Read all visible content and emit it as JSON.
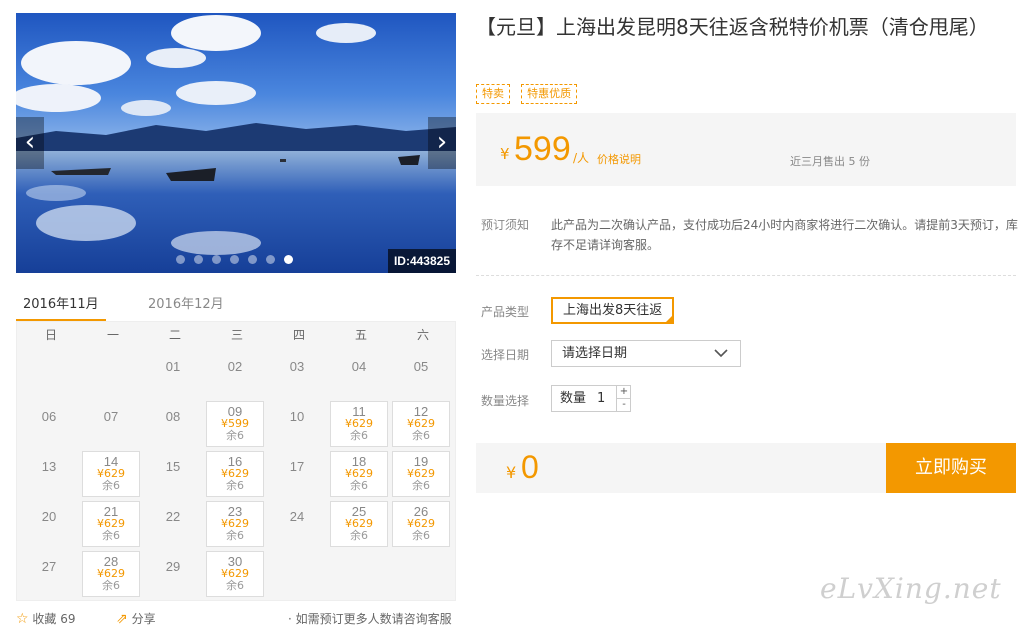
{
  "gallery": {
    "id_label": "ID:443825",
    "prev_glyph": "‹",
    "next_glyph": "›",
    "dot_count": 7,
    "active_dot": 6
  },
  "calendar": {
    "month_tabs": [
      {
        "label": "2016年11月",
        "active": true
      },
      {
        "label": "2016年12月",
        "active": false
      }
    ],
    "weekdays": [
      "日",
      "一",
      "二",
      "三",
      "四",
      "五",
      "六"
    ],
    "days": [
      {
        "day": "01",
        "col": 2,
        "row": 0
      },
      {
        "day": "02",
        "col": 3,
        "row": 0
      },
      {
        "day": "03",
        "col": 4,
        "row": 0
      },
      {
        "day": "04",
        "col": 5,
        "row": 0
      },
      {
        "day": "05",
        "col": 6,
        "row": 0
      },
      {
        "day": "06",
        "col": 0,
        "row": 1
      },
      {
        "day": "07",
        "col": 1,
        "row": 1
      },
      {
        "day": "08",
        "col": 2,
        "row": 1
      },
      {
        "day": "09",
        "col": 3,
        "row": 1,
        "price": "¥599",
        "stock": "余6"
      },
      {
        "day": "10",
        "col": 4,
        "row": 1
      },
      {
        "day": "11",
        "col": 5,
        "row": 1,
        "price": "¥629",
        "stock": "余6"
      },
      {
        "day": "12",
        "col": 6,
        "row": 1,
        "price": "¥629",
        "stock": "余6"
      },
      {
        "day": "13",
        "col": 0,
        "row": 2
      },
      {
        "day": "14",
        "col": 1,
        "row": 2,
        "price": "¥629",
        "stock": "余6"
      },
      {
        "day": "15",
        "col": 2,
        "row": 2
      },
      {
        "day": "16",
        "col": 3,
        "row": 2,
        "price": "¥629",
        "stock": "余6"
      },
      {
        "day": "17",
        "col": 4,
        "row": 2
      },
      {
        "day": "18",
        "col": 5,
        "row": 2,
        "price": "¥629",
        "stock": "余6"
      },
      {
        "day": "19",
        "col": 6,
        "row": 2,
        "price": "¥629",
        "stock": "余6"
      },
      {
        "day": "20",
        "col": 0,
        "row": 3
      },
      {
        "day": "21",
        "col": 1,
        "row": 3,
        "price": "¥629",
        "stock": "余6"
      },
      {
        "day": "22",
        "col": 2,
        "row": 3
      },
      {
        "day": "23",
        "col": 3,
        "row": 3,
        "price": "¥629",
        "stock": "余6"
      },
      {
        "day": "24",
        "col": 4,
        "row": 3
      },
      {
        "day": "25",
        "col": 5,
        "row": 3,
        "price": "¥629",
        "stock": "余6"
      },
      {
        "day": "26",
        "col": 6,
        "row": 3,
        "price": "¥629",
        "stock": "余6"
      },
      {
        "day": "27",
        "col": 0,
        "row": 4
      },
      {
        "day": "28",
        "col": 1,
        "row": 4,
        "price": "¥629",
        "stock": "余6"
      },
      {
        "day": "29",
        "col": 2,
        "row": 4
      },
      {
        "day": "30",
        "col": 3,
        "row": 4,
        "price": "¥629",
        "stock": "余6"
      }
    ]
  },
  "footer": {
    "favorite_icon": "star-icon",
    "favorite_label": "收藏 69",
    "share_icon": "share-icon",
    "share_label": "分享",
    "tip": "· 如需预订更多人数请咨询客服"
  },
  "product": {
    "title": "【元旦】上海出发昆明8天往返含税特价机票（清仓甩尾）",
    "tags": [
      "特卖",
      "特惠优质"
    ],
    "currency": "¥",
    "price": "599",
    "unit": "/人",
    "price_note": "价格说明",
    "sold": "近三月售出 5 份",
    "notice_label": "预订须知",
    "notice_text": "此产品为二次确认产品，支付成功后24小时内商家将进行二次确认。请提前3天预订，库存不足请详询客服。",
    "type_label": "产品类型",
    "type_value": "上海出发8天往返",
    "date_label": "选择日期",
    "date_placeholder": "请选择日期",
    "qty_row_label": "数量选择",
    "qty_inner_label": "数量",
    "qty_value": "1",
    "qty_plus": "+",
    "qty_minus": "-",
    "total_currency": "¥",
    "total": "0",
    "buy_label": "立即购买"
  },
  "watermark": "eLvXing.net",
  "colors": {
    "accent": "#f39800",
    "panel": "#f5f5f5"
  }
}
